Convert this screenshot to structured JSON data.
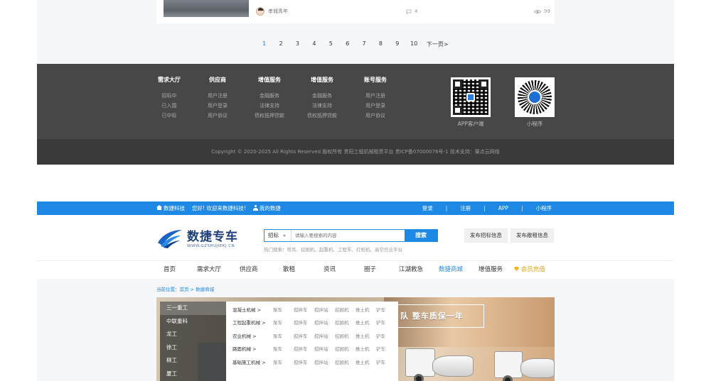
{
  "upper": {
    "card": {
      "author": "孝城青年",
      "comments": "4",
      "views": "99"
    },
    "pagination": {
      "pages": [
        "1",
        "2",
        "3",
        "4",
        "5",
        "6",
        "7",
        "8",
        "9",
        "10"
      ],
      "active": "1",
      "next": "下一页>"
    },
    "footer": {
      "columns": [
        {
          "title": "需求大厅",
          "items": [
            "招标中",
            "已入围",
            "已中标"
          ]
        },
        {
          "title": "供应商",
          "items": [
            "用户注册",
            "用户登录",
            "用户协议"
          ]
        },
        {
          "title": "增值服务",
          "items": [
            "金融服务",
            "法律支持",
            "债权抵押贷款"
          ]
        },
        {
          "title": "增值服务",
          "items": [
            "金融服务",
            "法律支持",
            "债权抵押贷款"
          ]
        },
        {
          "title": "账号服务",
          "items": [
            "用户注册",
            "用户登录",
            "用户协议"
          ]
        }
      ],
      "qr_app_label": "APP客户端",
      "qr_mini_label": "小程序",
      "copyright": "Copyright © 2020-2025 All Rights Reserved 版权所有 贵阳工程机械租赁平台 贵ICP备07000076号-1    技术支持：粟点云网络"
    }
  },
  "topbar": {
    "brand": "数捷科技",
    "welcome": "您好! 欢迎来数捷科技!",
    "my": "我的数捷",
    "links": [
      "登录",
      "|",
      "注册",
      "|",
      "APP",
      "|",
      "小程序"
    ]
  },
  "header": {
    "logo_title": "数捷专车",
    "logo_sub": "WWW.GZSHUJIEKJ.CN",
    "search": {
      "category": "招标",
      "placeholder": "请输入要搜索的内容",
      "button": "搜索"
    },
    "hot": "热门搜索：塔吊、挖掘机、起重机、工程车、打桩机、高空作业平台",
    "publish_bid": "发布招标信息",
    "publish_rent": "发布敞租信息"
  },
  "nav": {
    "items": [
      "首页",
      "需求大厅",
      "供应商",
      "散租",
      "资讯",
      "圈子",
      "江湖救急",
      "数捷商城",
      "增值服务"
    ],
    "active": "数捷商城",
    "vip": "会员充值"
  },
  "breadcrumb": "当前位置：首页 > 数捷商城",
  "banner": {
    "title": "队 整车质保一年"
  },
  "brands": [
    "三一重工",
    "中联重科",
    "龙工",
    "徐工",
    "柳工",
    "厦工"
  ],
  "categories": [
    {
      "name": "混凝土机械 >",
      "items": [
        "泵车",
        "搅拌车",
        "搅拌站",
        "挖掘机",
        "推土机",
        "铲车"
      ]
    },
    {
      "name": "工程起重机械 >",
      "items": [
        "泵车",
        "搅拌车",
        "搅拌站",
        "挖掘机",
        "推土机",
        "铲车"
      ]
    },
    {
      "name": "农业机械 >",
      "items": [
        "泵车",
        "搅拌车",
        "搅拌站",
        "挖掘机",
        "推土机",
        "铲车"
      ]
    },
    {
      "name": "路面机械 >",
      "items": [
        "泵车",
        "搅拌车",
        "搅拌站",
        "挖掘机",
        "推土机",
        "铲车"
      ]
    },
    {
      "name": "基础施工机械 >",
      "items": [
        "泵车",
        "搅拌车",
        "搅拌站",
        "挖掘机",
        "推土机",
        "铲车"
      ]
    }
  ],
  "colors": {
    "primary": "#1e88e5",
    "footer": "#474747",
    "vip": "#e6a20c"
  }
}
